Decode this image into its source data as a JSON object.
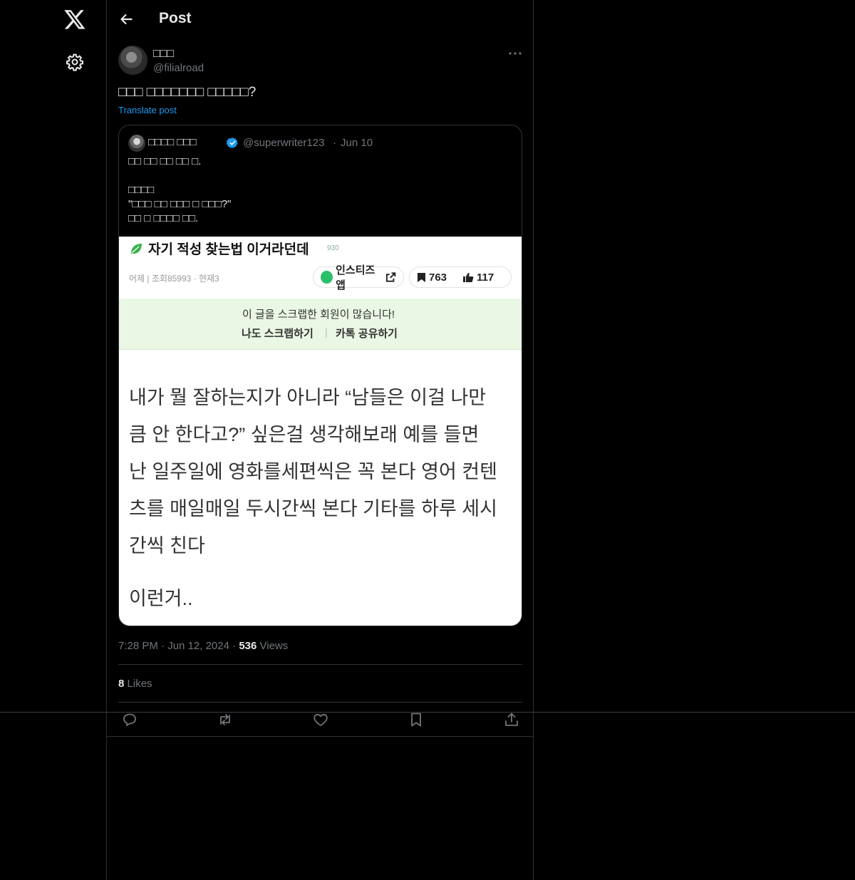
{
  "header": {
    "title": "Post"
  },
  "post": {
    "display_name": "□□□",
    "handle": "@filialroad",
    "text": "□□□ □□□□□□□ □□□□□?",
    "translate_label": "Translate post",
    "time": "7:28 PM",
    "date": "Jun 12, 2024",
    "views_count": "536",
    "views_label": "Views",
    "likes_count": "8",
    "likes_label": "Likes"
  },
  "quote": {
    "display_name": "□□□□ □□□",
    "verified": true,
    "handle": "@superwriter123",
    "separator": "·",
    "date": "Jun 10",
    "lines": [
      "□□ □□ □□ □□ □.",
      "",
      "□□□□",
      "\"□□□ □□ □□□ □ □□□?\"",
      "□□ □ □□□□ □□."
    ]
  },
  "screenshot": {
    "title": "자기 적성 찾는법 이거라던데",
    "badge": "930",
    "meta": "어제 | 조회85993 · 현재3",
    "app_label": "인스티즈앱",
    "bookmarks": "763",
    "likes": "117",
    "banner_line": "이 글을 스크랩한 회원이 많습니다!",
    "banner_scrap": "나도 스크랩하기",
    "banner_sep": "|",
    "banner_share": "카톡 공유하기",
    "body_lines": [
      "내가 뭘 잘하는지가 아니라 “남들은 이걸 나만",
      "큼 안 한다고?” 싶은걸 생각해보래 예를 들면",
      "난 일주일에 영화를세편씩은 꼭 본다 영어 컨텐",
      "츠를 매일매일 두시간씩 본다 기타를 하루 세시",
      "간씩 친다"
    ],
    "tail": "이런거.."
  },
  "icons": {
    "logo": "x-logo-icon",
    "settings": "gear-icon",
    "back": "arrow-left-icon",
    "more": "more-horizontal-icon",
    "verified": "verified-badge-icon",
    "reply": "reply-icon",
    "repost": "repost-icon",
    "like": "heart-icon",
    "bookmark": "bookmark-icon",
    "share": "share-icon"
  },
  "colors": {
    "accent": "#1d9bf0",
    "background": "#000000",
    "secondary_text": "#71767b",
    "border": "#2f3336"
  }
}
